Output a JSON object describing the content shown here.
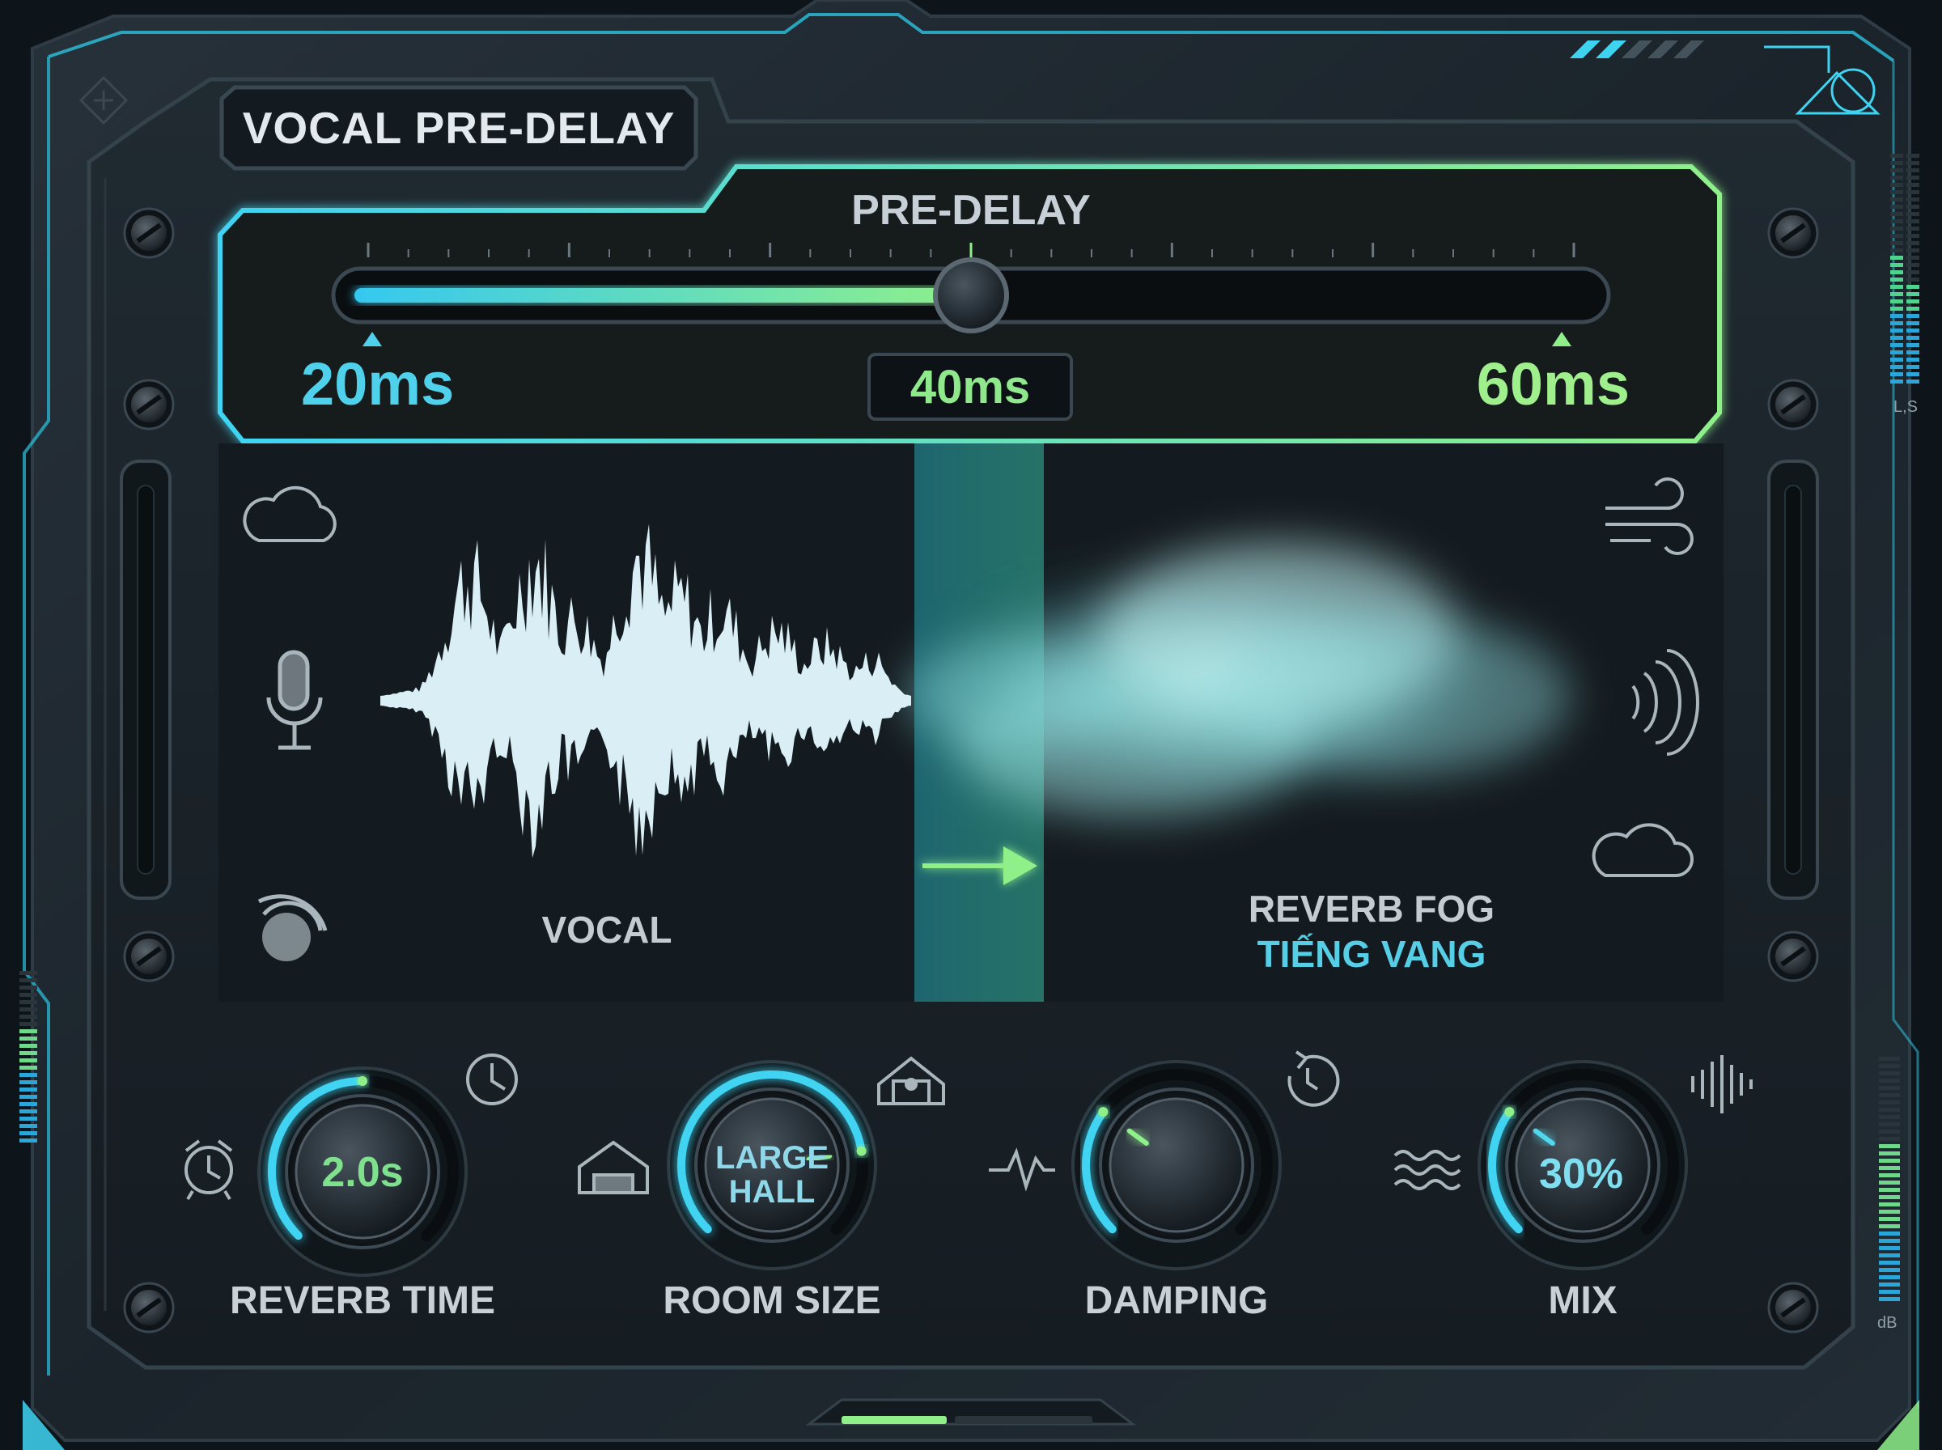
{
  "plugin": {
    "title": "VOCAL PRE-DELAY"
  },
  "predelay": {
    "label": "PRE-DELAY",
    "min_label": "20ms",
    "max_label": "60ms",
    "value_label": "40ms",
    "value_ms": 40,
    "min_ms": 20,
    "max_ms": 60
  },
  "visual": {
    "vocal_label": "VOCAL",
    "fog_label": "REVERB FOG",
    "fog_sublabel": "TIẾNG VANG"
  },
  "knobs": [
    {
      "label": "REVERB TIME",
      "value": "2.0s",
      "level": 0.5,
      "value_color": "#7fe08e"
    },
    {
      "label": "ROOM SIZE",
      "value_line1": "LARGE",
      "value_line2": "HALL",
      "level": 0.8,
      "value_color": "#8fd8ea"
    },
    {
      "label": "DAMPING",
      "value": "",
      "level": 0.3,
      "value_color": "#7fe08e"
    },
    {
      "label": "MIX",
      "value": "30%",
      "level": 0.3,
      "value_color": "#7fdff0"
    }
  ],
  "meters": {
    "right_top_label": "L,S",
    "right_bottom_label": "dB"
  },
  "colors": {
    "accent_cyan": "#3fd3f2",
    "accent_green": "#8ff08a",
    "panel_dark": "#151d23"
  },
  "icons": [
    "cloud-icon",
    "microphone-icon",
    "speaker-icon",
    "wind-icon",
    "sound-waves-icon",
    "cloud-icon",
    "alarm-clock-icon",
    "clock-icon",
    "house-icon",
    "concert-hall-icon",
    "pulse-icon",
    "reset-clock-icon",
    "waves-icon",
    "waveform-icon"
  ]
}
